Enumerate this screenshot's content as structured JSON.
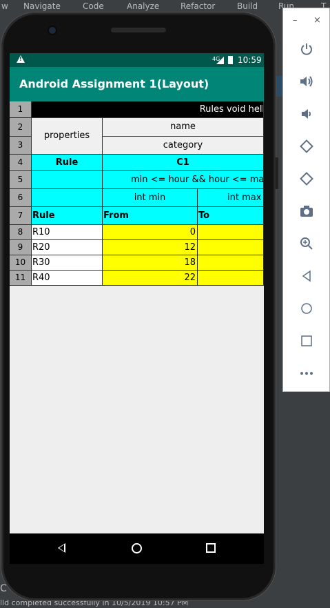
{
  "ide": {
    "top_text_fragments": [
      "w",
      "Navigate",
      "Code",
      "Analyze",
      "Refactor",
      "Build",
      "Run",
      "T"
    ],
    "bottom_text": "lld completed successfully in 10/5/2019 10:57 PM",
    "left_char": "C"
  },
  "status_bar": {
    "network": "4G",
    "time": "10:59"
  },
  "app_bar": {
    "title": "Android Assignment 1(Layout)"
  },
  "table": {
    "row_numbers": [
      "1",
      "2",
      "3",
      "4",
      "5",
      "6",
      "7",
      "8",
      "9",
      "10",
      "11"
    ],
    "row1_text": "Rules void hello",
    "properties_label": "properties",
    "name_label": "name",
    "category_label": "category",
    "rule_header": "Rule",
    "c1_header": "C1",
    "condition": "min <= hour && hour <= max",
    "int_min": "int min",
    "int_max": "int max",
    "col_rule": "Rule",
    "col_from": "From",
    "col_to": "To",
    "rows": [
      {
        "rule": "R10",
        "from": "0"
      },
      {
        "rule": "R20",
        "from": "12"
      },
      {
        "rule": "R30",
        "from": "18"
      },
      {
        "rule": "R40",
        "from": "22"
      }
    ]
  },
  "emulator_panel": {
    "minimize": "–",
    "close": "×",
    "buttons": [
      "power-icon",
      "volume-up-icon",
      "volume-down-icon",
      "rotate-left-icon",
      "rotate-right-icon",
      "camera-icon",
      "zoom-icon",
      "back-icon",
      "home-icon",
      "overview-icon",
      "more-icon"
    ]
  },
  "colors": {
    "status_bar": "#00574b",
    "app_bar": "#008577",
    "cyan": "#00ffff",
    "yellow": "#ffff00",
    "row_header": "#aaaaaa"
  }
}
